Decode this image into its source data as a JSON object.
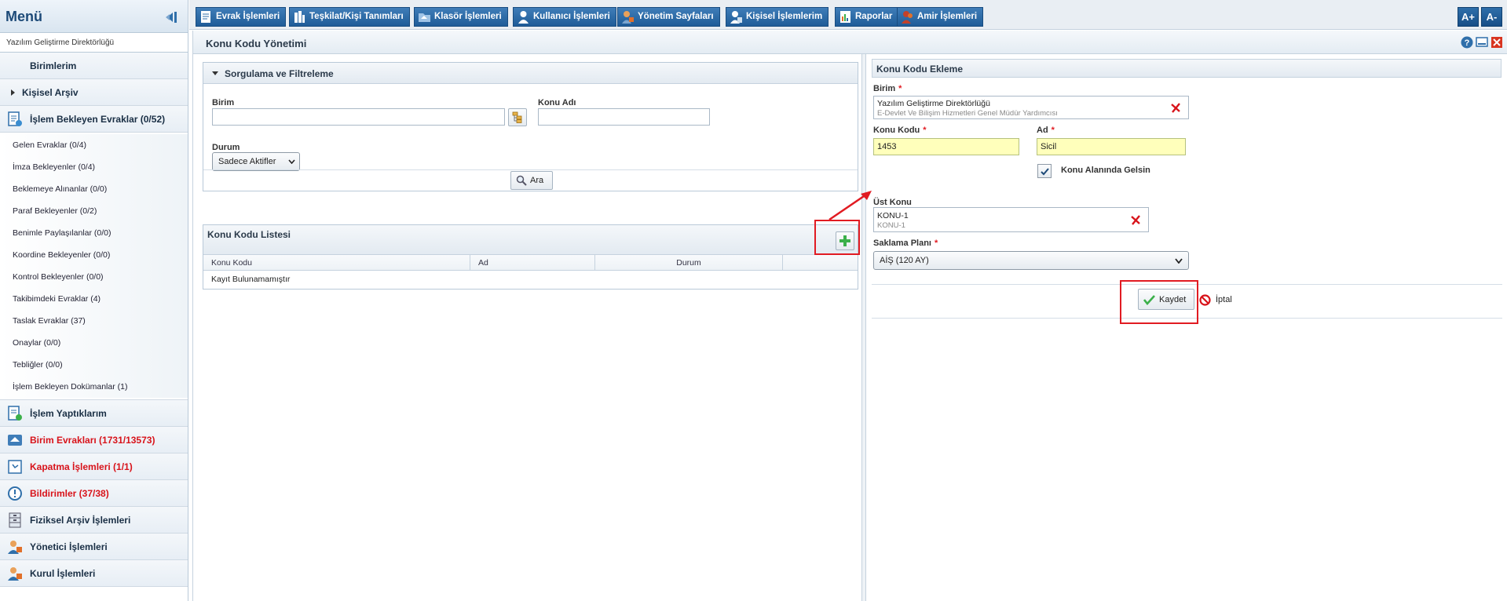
{
  "sidebar": {
    "title": "Menü",
    "org": "Yazılım Geliştirme Direktörlüğü",
    "birimlerim": "Birimlerim",
    "kisisel_arsiv": "Kişisel Arşiv",
    "islem_bekleyen": "İşlem Bekleyen Evraklar (0/52)",
    "sub_items": [
      "Gelen Evraklar (0/4)",
      "İmza Bekleyenler (0/4)",
      "Beklemeye Alınanlar (0/0)",
      "Paraf Bekleyenler (0/2)",
      "Benimle Paylaşılanlar (0/0)",
      "Koordine Bekleyenler (0/0)",
      "Kontrol Bekleyenler (0/0)",
      "Takibimdeki Evraklar (4)",
      "Taslak Evraklar (37)",
      "Onaylar (0/0)",
      "Tebliğler (0/0)",
      "İşlem Bekleyen Dokümanlar (1)"
    ],
    "islem_yaptiklarim": "İşlem Yaptıklarım",
    "birim_evraklari": "Birim Evrakları (1731/13573)",
    "kapatma": "Kapatma İşlemleri (1/1)",
    "bildirimler": "Bildirimler (37/38)",
    "fiziksel": "Fiziksel Arşiv İşlemleri",
    "yonetici": "Yönetici İşlemleri",
    "kurul": "Kurul İşlemleri"
  },
  "topbar": {
    "tabs": [
      "Evrak İşlemleri",
      "Teşkilat/Kişi Tanımları",
      "Klasör İşlemleri",
      "Kullanıcı İşlemleri",
      "Yönetim Sayfaları",
      "Kişisel İşlemlerim",
      "Raporlar",
      "Amir İşlemleri"
    ],
    "font_up": "A+",
    "font_down": "A-"
  },
  "main": {
    "title": "Konu Kodu Yönetimi",
    "filter": {
      "header": "Sorgulama ve Filtreleme",
      "birim_label": "Birim",
      "birim_value": "",
      "konu_adi_label": "Konu Adı",
      "konu_adi_value": "",
      "durum_label": "Durum",
      "durum_value": "Sadece Aktifler",
      "search_label": "Ara"
    },
    "list": {
      "header": "Konu Kodu Listesi",
      "columns": [
        "Konu Kodu",
        "Ad",
        "Durum"
      ],
      "empty": "Kayıt Bulunamamıştır"
    },
    "form": {
      "header": "Konu Kodu Ekleme",
      "birim_label": "Birim",
      "birim_value": "Yazılım Geliştirme Direktörlüğü",
      "birim_sub": "E-Devlet Ve Bilişim Hizmetleri Genel Müdür Yardımcısı",
      "konu_kodu_label": "Konu Kodu",
      "konu_kodu_value": "1453",
      "ad_label": "Ad",
      "ad_value": "Sicil",
      "checkbox_label": "Konu Alanında Gelsin",
      "checkbox_checked": true,
      "ust_konu_label": "Üst Konu",
      "ust_konu_value": "KONU-1",
      "ust_konu_sub": "KONU-1",
      "saklama_label": "Saklama Planı",
      "saklama_value": "AİŞ (120 AY)",
      "save_label": "Kaydet",
      "cancel_label": "İptal",
      "required_mark": "*"
    }
  },
  "colors": {
    "accent": "#1f5c98",
    "highlight": "#e11b22",
    "required_fill": "#ffffbb"
  }
}
